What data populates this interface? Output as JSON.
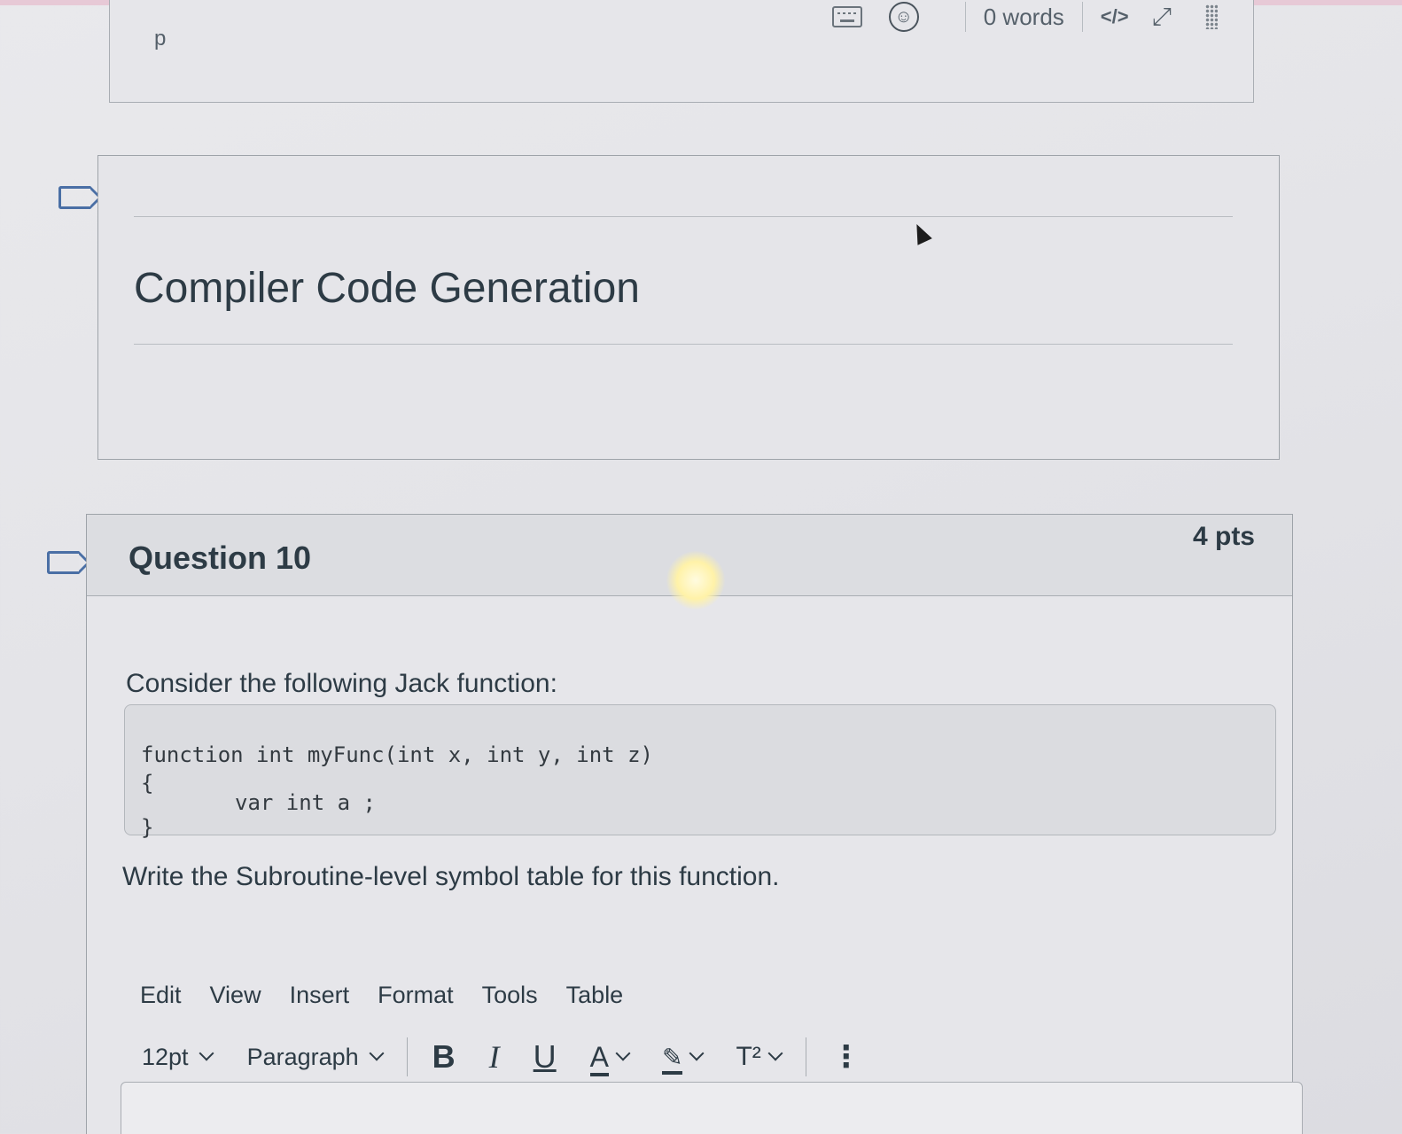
{
  "previous_editor": {
    "path_label": "p",
    "status": {
      "keyboard_icon": "keyboard-icon",
      "accessibility_icon": "accessibility-icon",
      "word_count": "0 words",
      "html_toggle": "</>",
      "expand_icon": "resize-icon",
      "drag_icon": "drag-handle-icon"
    }
  },
  "text_block": {
    "title": "Compiler Code Generation"
  },
  "question": {
    "title": "Question 10",
    "points": "4 pts",
    "intro": "Consider the following Jack function:",
    "code": {
      "line1": "function int myFunc(int x, int y, int z)",
      "line2": "{",
      "line3": "var int a ;",
      "line4": "}"
    },
    "instruction": "Write the Subroutine-level symbol table for this function.",
    "editor": {
      "menu": [
        "Edit",
        "View",
        "Insert",
        "Format",
        "Tools",
        "Table"
      ],
      "font_size": "12pt",
      "block_format": "Paragraph",
      "bold": "B",
      "italic": "I",
      "underline": "U",
      "text_color": "A",
      "highlight": "✎",
      "superscript": "T²",
      "more": "⋮"
    }
  },
  "colors": {
    "flag": "#4a6fa5",
    "text": "#2d3b45",
    "panel": "#e6e6ea"
  }
}
